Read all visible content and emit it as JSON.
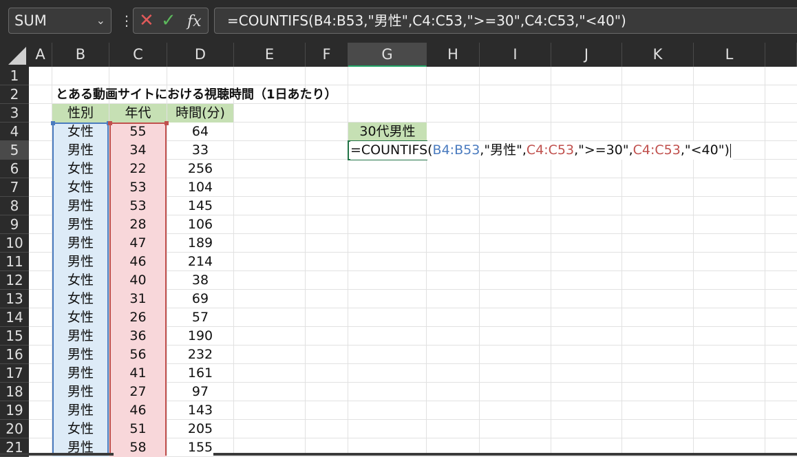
{
  "namebox": {
    "value": "SUM",
    "icon": "chevron-down-icon"
  },
  "formula_bar": {
    "icons": [
      "cancel-icon",
      "enter-icon",
      "function-icon"
    ],
    "fx_label": "fx",
    "formula": "=COUNTIFS(B4:B53,\"男性\",C4:C53,\">=30\",C4:C53,\"<40\")"
  },
  "columns": [
    "A",
    "B",
    "C",
    "D",
    "E",
    "F",
    "G",
    "H",
    "I",
    "J",
    "K",
    "L"
  ],
  "selected_column": "G",
  "rows": [
    "1",
    "2",
    "3",
    "4",
    "5",
    "6",
    "7",
    "8",
    "9",
    "10",
    "11",
    "12",
    "13",
    "14",
    "15",
    "16",
    "17",
    "18",
    "19",
    "20",
    "21"
  ],
  "selected_row": "5",
  "sheet": {
    "title": "とある動画サイトにおける視聴時間（1日あたり）",
    "headers": {
      "gender": "性別",
      "age": "年代",
      "time": "時間(分)"
    },
    "data": [
      {
        "gender": "女性",
        "age": "55",
        "time": "64"
      },
      {
        "gender": "男性",
        "age": "34",
        "time": "33"
      },
      {
        "gender": "女性",
        "age": "22",
        "time": "256"
      },
      {
        "gender": "女性",
        "age": "53",
        "time": "104"
      },
      {
        "gender": "男性",
        "age": "53",
        "time": "145"
      },
      {
        "gender": "男性",
        "age": "28",
        "time": "106"
      },
      {
        "gender": "男性",
        "age": "47",
        "time": "189"
      },
      {
        "gender": "男性",
        "age": "46",
        "time": "214"
      },
      {
        "gender": "女性",
        "age": "40",
        "time": "38"
      },
      {
        "gender": "女性",
        "age": "31",
        "time": "69"
      },
      {
        "gender": "女性",
        "age": "26",
        "time": "57"
      },
      {
        "gender": "男性",
        "age": "36",
        "time": "190"
      },
      {
        "gender": "男性",
        "age": "56",
        "time": "232"
      },
      {
        "gender": "男性",
        "age": "41",
        "time": "161"
      },
      {
        "gender": "男性",
        "age": "27",
        "time": "97"
      },
      {
        "gender": "男性",
        "age": "46",
        "time": "143"
      },
      {
        "gender": "女性",
        "age": "51",
        "time": "205"
      },
      {
        "gender": "男性",
        "age": "58",
        "time": "155"
      }
    ],
    "g4_label": "30代男性",
    "g5_formula_parts": {
      "p1": "=COUNTIFS(",
      "ref1": "B4:B53",
      "p2": ",\"男性\",",
      "ref2": "C4:C53",
      "p3": ",\">=30\",",
      "ref3": "C4:C53",
      "p4": ",\"<40\")"
    }
  },
  "colors": {
    "header_green": "#c6e0b4",
    "range_blue": "#4a7bbf",
    "range_red": "#c0504d",
    "selection_green": "#217346"
  }
}
